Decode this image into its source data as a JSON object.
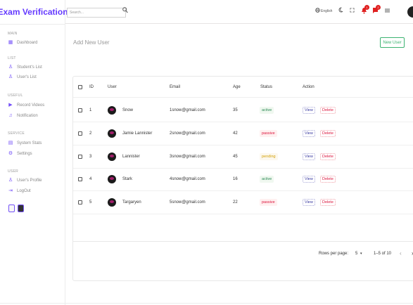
{
  "app": {
    "title": "Exam Verification"
  },
  "sidebar": {
    "sections": [
      {
        "title": "MAIN",
        "items": [
          {
            "label": "Dashboard",
            "icon": "dashboard-icon",
            "glyph": "▦"
          }
        ]
      },
      {
        "title": "LIST",
        "items": [
          {
            "label": "Student's List",
            "icon": "person-outline-icon",
            "glyph": "♙"
          },
          {
            "label": "User's List",
            "icon": "person-icon",
            "glyph": "♙"
          }
        ]
      },
      {
        "title": "USEFUL",
        "items": [
          {
            "label": "Record Videos",
            "icon": "video-icon",
            "glyph": "▶"
          },
          {
            "label": "Notification",
            "icon": "bell-icon",
            "glyph": "♫"
          }
        ]
      },
      {
        "title": "SERVICE",
        "items": [
          {
            "label": "System Stats",
            "icon": "stats-icon",
            "glyph": "▤"
          },
          {
            "label": "Settings",
            "icon": "gear-icon",
            "glyph": "⚙"
          }
        ]
      },
      {
        "title": "USER",
        "items": [
          {
            "label": "User's Profile",
            "icon": "profile-icon",
            "glyph": "♙"
          },
          {
            "label": "LogOut",
            "icon": "logout-icon",
            "glyph": "⇥"
          }
        ]
      }
    ],
    "theme_options": [
      "light",
      "dark"
    ]
  },
  "topbar": {
    "search_placeholder": "Search...",
    "language": "English",
    "icons": [
      "language-icon",
      "dark-mode-icon",
      "fullscreen-icon",
      "notification-icon",
      "chat-icon",
      "list-icon",
      "avatar"
    ],
    "notification_count": "1",
    "chat_count": "2"
  },
  "main": {
    "title": "Add New User",
    "new_button": "New User"
  },
  "table": {
    "columns": [
      "ID",
      "User",
      "Email",
      "Age",
      "Status",
      "Action"
    ],
    "rows": [
      {
        "id": "1",
        "user": "Snow",
        "email": "1snow@gmail.com",
        "age": "35",
        "status": "active"
      },
      {
        "id": "2",
        "user": "Jamie Lannister",
        "email": "2snow@gmail.com",
        "age": "42",
        "status": "passive"
      },
      {
        "id": "3",
        "user": "Lannister",
        "email": "3snow@gmail.com",
        "age": "45",
        "status": "pending"
      },
      {
        "id": "4",
        "user": "Stark",
        "email": "4snow@gmail.com",
        "age": "16",
        "status": "active"
      },
      {
        "id": "5",
        "user": "Targaryen",
        "email": "5snow@gmail.com",
        "age": "22",
        "status": "passive"
      }
    ],
    "view_label": "View",
    "delete_label": "Delete",
    "rows_per_page_label": "Rows per page:",
    "rows_per_page": "5",
    "range": "1–5 of 10",
    "prev_glyph": "‹",
    "next_glyph": "›"
  },
  "colors": {
    "brand": "#6439ff",
    "active": "#2e8b57",
    "passive": "#dc143c",
    "pending": "#d4a20a",
    "new_button": "#3cb371"
  }
}
